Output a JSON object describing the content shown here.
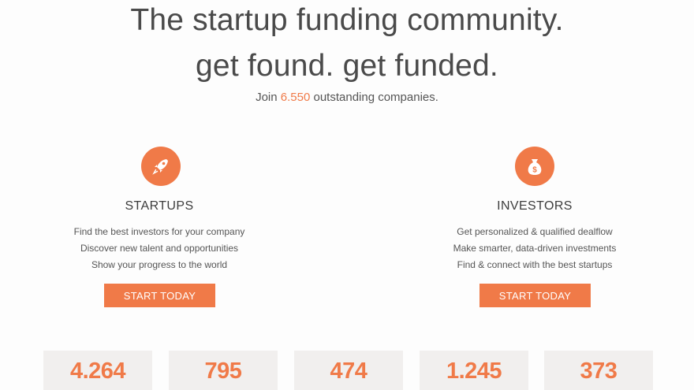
{
  "hero": {
    "headline_line1": "The startup funding community.",
    "headline_line2": "get found. get funded.",
    "join_prefix": "Join",
    "join_count": "6.550",
    "join_suffix": "outstanding companies."
  },
  "startups": {
    "icon": "rocket-icon",
    "title": "STARTUPS",
    "features": [
      "Find the best investors for your company",
      "Discover new talent and opportunities",
      "Show your progress to the world"
    ],
    "cta_label": "START TODAY"
  },
  "investors": {
    "icon": "money-bag-icon",
    "title": "INVESTORS",
    "features": [
      "Get personalized & qualified dealflow",
      "Make smarter, data-driven investments",
      "Find & connect with the best startups"
    ],
    "cta_label": "START TODAY"
  },
  "stats": [
    "4.264",
    "795",
    "474",
    "1.245",
    "373"
  ],
  "colors": {
    "accent": "#f07a48",
    "text": "#4a4a4a",
    "stat_bg": "#f1efee"
  }
}
